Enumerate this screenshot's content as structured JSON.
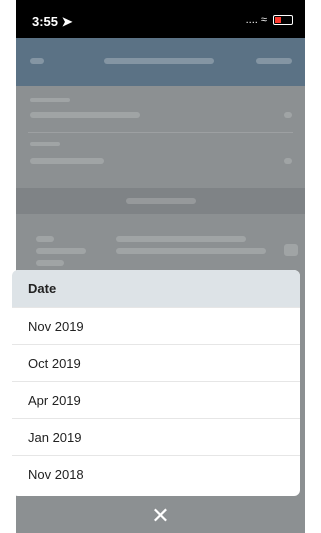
{
  "status_bar": {
    "time": "3:55",
    "location_icon": "arrow-icon",
    "signal": "....",
    "wifi_icon": "wifi-icon",
    "battery_icon": "battery-icon"
  },
  "sheet": {
    "header": "Date",
    "options": [
      "Nov 2019",
      "Oct 2019",
      "Apr 2019",
      "Jan 2019",
      "Nov 2018"
    ]
  },
  "close_icon": "close-icon",
  "colors": {
    "overlay": "#8a8d90",
    "header_bg": "#dde3e7",
    "sheet_bg": "#ffffff"
  }
}
